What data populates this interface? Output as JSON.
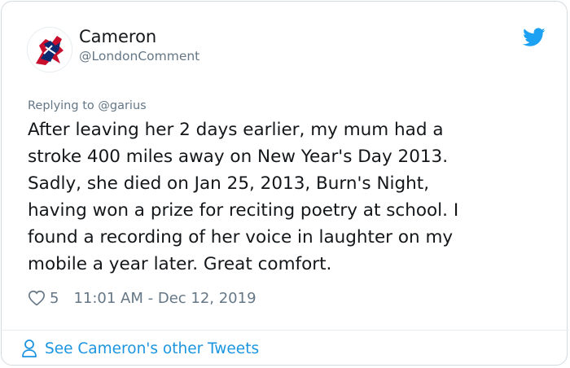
{
  "user": {
    "name": "Cameron",
    "handle": "@LondonComment"
  },
  "reply_to": {
    "prefix": "Replying to ",
    "handle": "@garius"
  },
  "tweet": {
    "text": "After leaving her 2 days earlier, my mum had a\nstroke 400 miles away on New Year's Day 2013.\nSadly, she died on Jan 25, 2013, Burn's Night,\nhaving won a prize for reciting poetry at school.  I\nfound a recording of her voice in laughter on my\nmobile a year later.  Great comfort."
  },
  "meta": {
    "like_count": "5",
    "timestamp": "11:01 AM - Dec 12, 2019"
  },
  "footer": {
    "link_text": "See Cameron's other Tweets"
  },
  "icons": {
    "brand": "twitter-bird-icon",
    "like": "heart-icon",
    "profile": "person-icon"
  },
  "colors": {
    "brand_blue": "#1da1f2",
    "link_blue": "#1b95e0",
    "secondary_text": "#657786",
    "primary_text": "#14171a"
  }
}
